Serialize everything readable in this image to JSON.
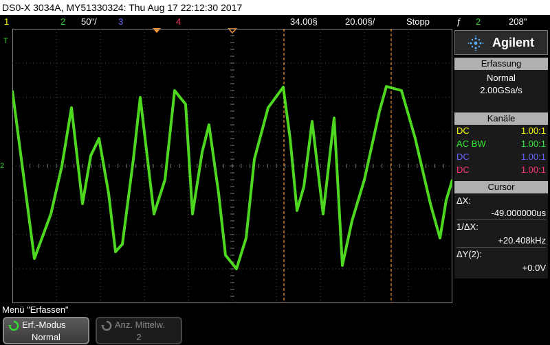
{
  "window": {
    "title": "DS0-X 3034A, MY51330324: Thu Aug 17 22:12:30 2017"
  },
  "status": {
    "ch1": "1",
    "ch2": "2",
    "ch2_scale": "50\"/",
    "ch3": "3",
    "ch4": "4",
    "delay": "34.00§",
    "timebase": "20.00§/",
    "run_state": "Stopp",
    "trigger_symbol": "ƒ",
    "trigger_channel": "2",
    "trigger_level": "208\""
  },
  "colors": {
    "ch1": "#ffff00",
    "ch2": "#33cc33",
    "ch3": "#6666ff",
    "ch4": "#ff3366",
    "trace": "#55ee22",
    "cursor": "#ff9933"
  },
  "scope": {
    "ground_marker": "2",
    "trigger_marker": "T"
  },
  "sidebar": {
    "logo": "Agilent",
    "acquisition": {
      "header": "Erfassung",
      "mode": "Normal",
      "rate": "2.00GSa/s"
    },
    "channels": {
      "header": "Kanäle",
      "rows": [
        {
          "coupling": "DC",
          "ratio": "1.00:1",
          "color": "#ffff00"
        },
        {
          "coupling": "AC BW",
          "ratio": "1.00:1",
          "color": "#33ee33"
        },
        {
          "coupling": "DC",
          "ratio": "1.00:1",
          "color": "#6666ff"
        },
        {
          "coupling": "DC",
          "ratio": "1.00:1",
          "color": "#ff3377"
        }
      ]
    },
    "cursor": {
      "header": "Cursor",
      "dx_label": "ΔX:",
      "dx_value": "-49.000000us",
      "inv_dx_label": "1/ΔX:",
      "inv_dx_value": "+20.408kHz",
      "dy_label": "ΔY(2):",
      "dy_value": "+0.0V"
    }
  },
  "menu": {
    "title": "Menü \"Erfassen\"",
    "softkeys": [
      {
        "label": "Erf.-Modus",
        "value": "Normal"
      },
      {
        "label": "Anz. Mittelw.",
        "value": "2"
      }
    ]
  }
}
